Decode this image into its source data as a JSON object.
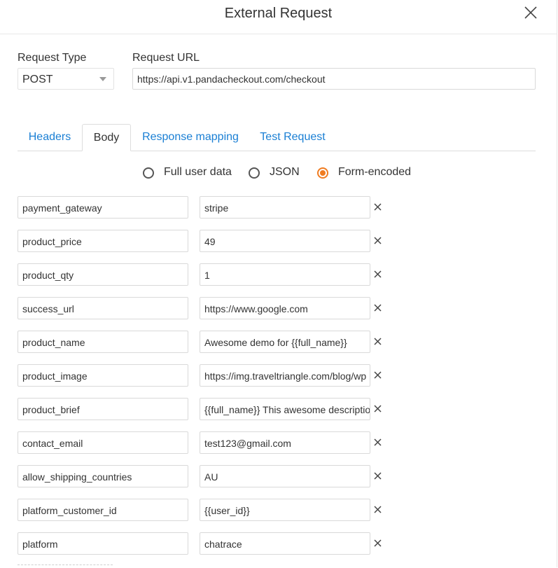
{
  "modal": {
    "title": "External Request",
    "close_icon": "close-icon"
  },
  "request": {
    "type_label": "Request Type",
    "type_value": "POST",
    "url_label": "Request URL",
    "url_value": "https://api.v1.pandacheckout.com/checkout"
  },
  "tabs": [
    {
      "label": "Headers",
      "active": false
    },
    {
      "label": "Body",
      "active": true
    },
    {
      "label": "Response mapping",
      "active": false
    },
    {
      "label": "Test Request",
      "active": false
    }
  ],
  "body_format": {
    "options": [
      {
        "label": "Full user data",
        "checked": false
      },
      {
        "label": "JSON",
        "checked": false
      },
      {
        "label": "Form-encoded",
        "checked": true
      }
    ]
  },
  "params": [
    {
      "key": "payment_gateway",
      "value": "stripe"
    },
    {
      "key": "product_price",
      "value": "49"
    },
    {
      "key": "product_qty",
      "value": "1"
    },
    {
      "key": "success_url",
      "value": "https://www.google.com"
    },
    {
      "key": "product_name",
      "value": "Awesome demo for {{full_name}}"
    },
    {
      "key": "product_image",
      "value": "https://img.traveltriangle.com/blog/wp"
    },
    {
      "key": "product_brief",
      "value": "{{full_name}} This awesome description"
    },
    {
      "key": "contact_email",
      "value": "test123@gmail.com"
    },
    {
      "key": "allow_shipping_countries",
      "value": "AU"
    },
    {
      "key": "platform_customer_id",
      "value": "{{user_id}}"
    },
    {
      "key": "platform",
      "value": "chatrace"
    }
  ],
  "colors": {
    "accent": "#f07c21",
    "link": "#1a7fd4",
    "text": "#333333",
    "border": "#d9d9d9"
  }
}
